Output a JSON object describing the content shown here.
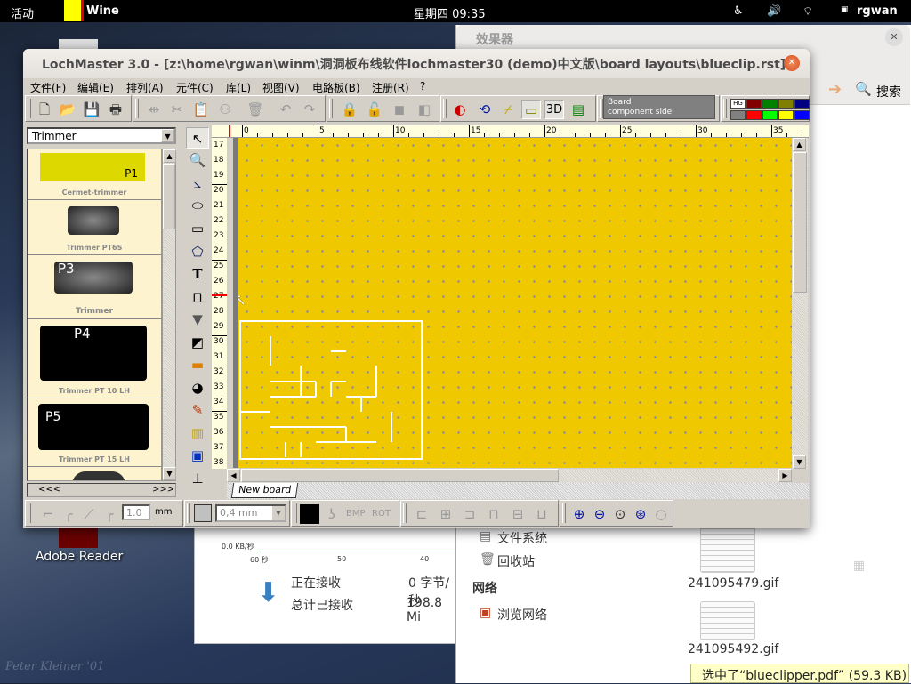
{
  "topbar": {
    "activities": "活动",
    "app": "Wine",
    "clock": "星期四 09:35",
    "user": "rgwan",
    "icons": [
      "accessibility-icon",
      "volume-icon",
      "wifi-icon"
    ]
  },
  "desktop": {
    "adobe_label": "Adobe Reader",
    "signature": "Peter Kleiner '01"
  },
  "sysmon": {
    "axis_value": "0.0 KB/秒",
    "ticks": [
      "60 秒",
      "50",
      "40"
    ],
    "receiving_label": "正在接收",
    "receiving_value": "0 字节/秒",
    "total_label": "总计已接收",
    "total_value": "198.8 Mi"
  },
  "filemanager": {
    "title": "效果器",
    "search": "搜索",
    "sidebar": [
      "文件系统",
      "回收站"
    ],
    "network_header": "网络",
    "network_items": [
      "浏览网络"
    ],
    "files": [
      "241095479.gif",
      "241095492.gif"
    ],
    "status_tooltip": "选中了“blueclipper.pdf” (59.3 KB)"
  },
  "lochmaster": {
    "title": "LochMaster 3.0 - [z:\\home\\rgwan\\winm\\洞洞板布线软件lochmaster30 (demo)中文版\\board layouts\\blueclip.rst]",
    "menu": [
      "文件(F)",
      "编辑(E)",
      "排列(A)",
      "元件(C)",
      "库(L)",
      "视图(V)",
      "电路板(B)",
      "注册(R)",
      "?"
    ],
    "board_side": [
      "Board",
      "component side"
    ],
    "view_3d": "3D",
    "palette": [
      "#800000",
      "#008000",
      "#808000",
      "#000080",
      "#808080",
      "#ff0000",
      "#00ff00",
      "#ffff00",
      "#0000ff"
    ],
    "library": {
      "selected": "Trimmer",
      "items": [
        "Cermet-trimmer",
        "Trimmer PT6S",
        "Trimmer",
        "Trimmer PT 10 LH",
        "Trimmer PT 15 LH"
      ],
      "part_labels": [
        "P1",
        "P3",
        "P4",
        "P5"
      ],
      "nav_prev": "<<<",
      "nav_next": ">>>"
    },
    "ruler_x": [
      "0",
      "5",
      "10",
      "15",
      "20",
      "25",
      "30",
      "35"
    ],
    "ruler_y": [
      "17",
      "18",
      "19",
      "20",
      "21",
      "22",
      "23",
      "24",
      "25",
      "26",
      "27",
      "28",
      "29",
      "30",
      "31",
      "32",
      "33",
      "34",
      "35",
      "36",
      "37",
      "38"
    ],
    "tab": "New board",
    "bottom": {
      "radius_value": "1.0",
      "unit": "mm",
      "track_width": "0,4 mm",
      "bmp": "BMP",
      "rot": "ROT"
    },
    "canvas_color": "#f0c800"
  }
}
